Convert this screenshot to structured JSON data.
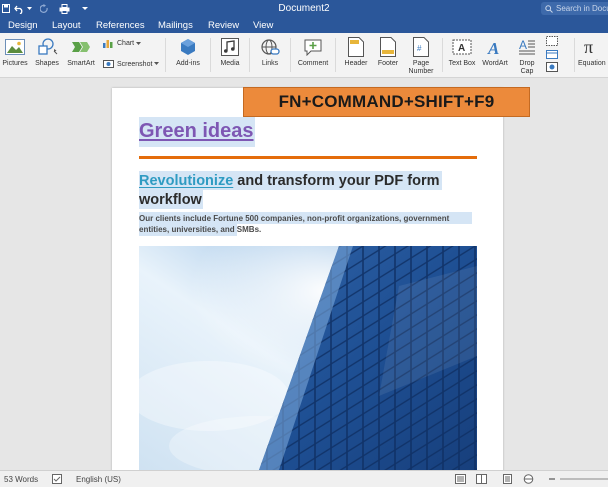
{
  "window": {
    "title": "Document2",
    "search_placeholder": "Search in Document"
  },
  "tabs": [
    {
      "label": "Design"
    },
    {
      "label": "Layout"
    },
    {
      "label": "References"
    },
    {
      "label": "Mailings"
    },
    {
      "label": "Review"
    },
    {
      "label": "View"
    }
  ],
  "ribbon": {
    "pictures": "Pictures",
    "shapes": "Shapes",
    "smartart": "SmartArt",
    "chart": "Chart",
    "screenshot": "Screenshot",
    "addins": "Add-ins",
    "media": "Media",
    "links": "Links",
    "comment": "Comment",
    "header": "Header",
    "footer": "Footer",
    "page_number": "Page Number",
    "text_box": "Text Box",
    "wordart": "WordArt",
    "drop_cap": "Drop Cap",
    "equation": "Equation"
  },
  "document": {
    "heading": "Green ideas",
    "subheading_accent": "Revolutionize",
    "subheading_rest": " and transform your PDF form workflow",
    "paragraph": "Our clients include Fortune 500 companies, non-profit organizations, government entities, universities, and SMBs."
  },
  "overlay": {
    "shortcut": "FN+COMMAND+SHIFT+F9"
  },
  "status": {
    "word_count": "53 Words",
    "language": "English (US)"
  },
  "colors": {
    "brand": "#2b579a",
    "heading": "#7e57b3",
    "accent": "#2f9bc2",
    "rule": "#e46c0a",
    "selection": "#d5e5f5",
    "overlay": "#ec8a3b"
  }
}
